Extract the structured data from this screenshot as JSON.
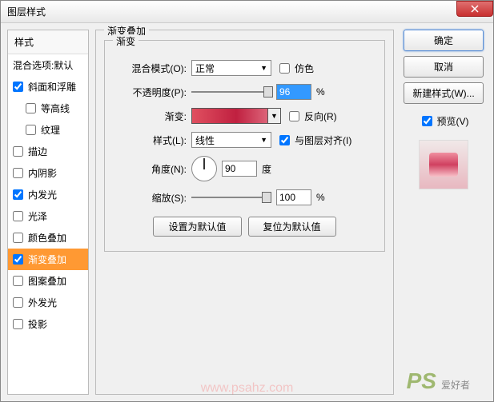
{
  "title": "图层样式",
  "leftpanel": {
    "header": "样式",
    "blend_options": "混合选项:默认",
    "items": [
      {
        "label": "斜面和浮雕",
        "checked": true
      },
      {
        "label": "等高线",
        "checked": false,
        "indent": true
      },
      {
        "label": "纹理",
        "checked": false,
        "indent": true
      },
      {
        "label": "描边",
        "checked": false
      },
      {
        "label": "内阴影",
        "checked": false
      },
      {
        "label": "内发光",
        "checked": true
      },
      {
        "label": "光泽",
        "checked": false
      },
      {
        "label": "颜色叠加",
        "checked": false
      },
      {
        "label": "渐变叠加",
        "checked": true,
        "active": true
      },
      {
        "label": "图案叠加",
        "checked": false
      },
      {
        "label": "外发光",
        "checked": false
      },
      {
        "label": "投影",
        "checked": false
      }
    ]
  },
  "group": {
    "title": "渐变叠加",
    "inner_title": "渐变",
    "blend_mode_label": "混合模式(O):",
    "blend_mode_value": "正常",
    "dither_label": "仿色",
    "opacity_label": "不透明度(P):",
    "opacity_value": "96",
    "opacity_unit": "%",
    "gradient_label": "渐变:",
    "reverse_label": "反向(R)",
    "style_label": "样式(L):",
    "style_value": "线性",
    "align_label": "与图层对齐(I)",
    "angle_label": "角度(N):",
    "angle_value": "90",
    "angle_unit": "度",
    "scale_label": "缩放(S):",
    "scale_value": "100",
    "scale_unit": "%",
    "reset_default": "设置为默认值",
    "restore_default": "复位为默认值"
  },
  "rightpanel": {
    "ok": "确定",
    "cancel": "取消",
    "new_style": "新建样式(W)...",
    "preview_label": "预览(V)"
  },
  "watermark": "www.psahz.com",
  "logo": {
    "ps": "PS",
    "text": "爱好者"
  }
}
